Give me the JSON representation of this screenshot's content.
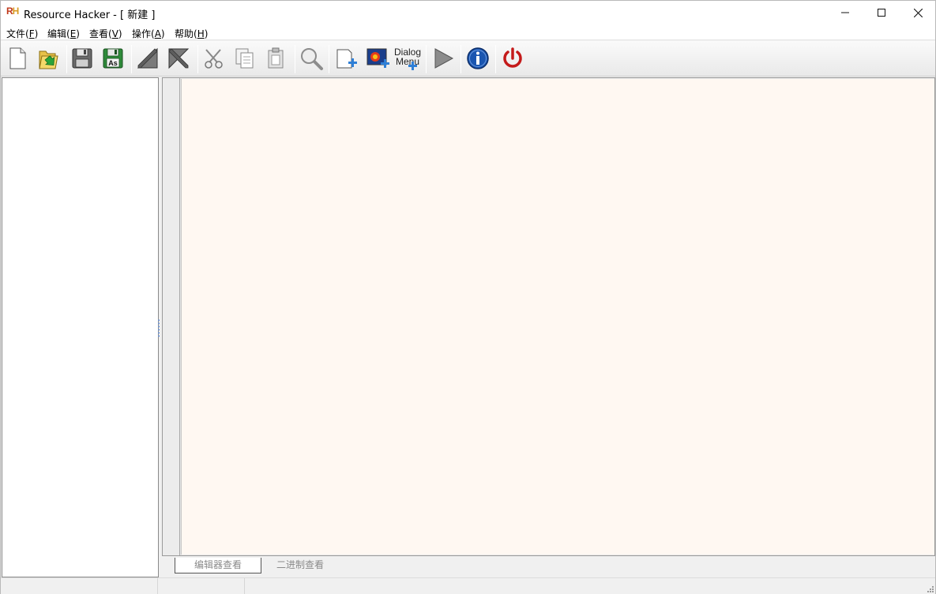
{
  "window": {
    "logo": "RH",
    "title": "Resource Hacker - [ 新建 ]"
  },
  "menu": {
    "file": {
      "label": "文件(",
      "key": "F",
      "end": ")"
    },
    "edit": {
      "label": "编辑(",
      "key": "E",
      "end": ")"
    },
    "view": {
      "label": "查看(",
      "key": "V",
      "end": ")"
    },
    "action": {
      "label": "操作(",
      "key": "A",
      "end": ")"
    },
    "help": {
      "label": "帮助(",
      "key": "H",
      "end": ")"
    }
  },
  "toolbar": {
    "dialog_menu_line1": "Dialog",
    "dialog_menu_line2": "Menu",
    "icons": [
      "new-file-icon",
      "open-folder-icon",
      "save-icon",
      "save-as-icon",
      "previous-icon",
      "next-icon",
      "cut-icon",
      "copy-icon",
      "paste-icon",
      "search-icon",
      "add-resource-icon",
      "add-image-icon",
      "dialog-menu-icon",
      "run-icon",
      "about-icon",
      "exit-icon"
    ],
    "save_as_text": "As"
  },
  "tabs": {
    "editor_view": "编辑器查看",
    "binary_view": "二进制查看"
  },
  "statusbar": {
    "pane1": "",
    "pane2": "",
    "pane3": ""
  },
  "colors": {
    "editor_bg": "#fff8f2",
    "info_blue": "#1a55b0",
    "power_red": "#c41a1a"
  }
}
